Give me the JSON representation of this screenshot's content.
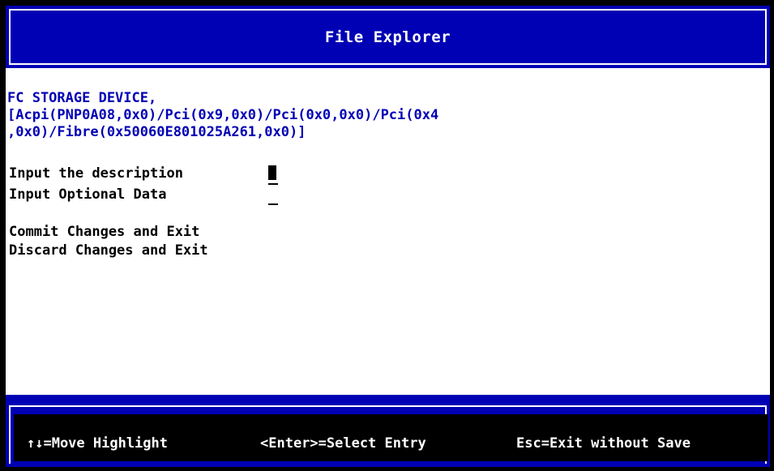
{
  "header": {
    "title": "File Explorer"
  },
  "device": {
    "lines": [
      "FC STORAGE DEVICE,",
      "[Acpi(PNP0A08,0x0)/Pci(0x9,0x0)/Pci(0x0,0x0)/Pci(0x4",
      ",0x0)/Fibre(0x50060E801025A261,0x0)]"
    ]
  },
  "fields": {
    "description_label": "Input the description",
    "optional_label": "Input Optional Data"
  },
  "menu": {
    "commit_label": "Commit Changes and Exit",
    "discard_label": "Discard Changes and Exit"
  },
  "footer": {
    "move": "↑↓=Move Highlight",
    "select": "<Enter>=Select Entry",
    "exit": "Esc=Exit without Save"
  },
  "colors": {
    "accent_blue": "#0000b4",
    "background": "#ffffff",
    "frame": "#000000"
  }
}
